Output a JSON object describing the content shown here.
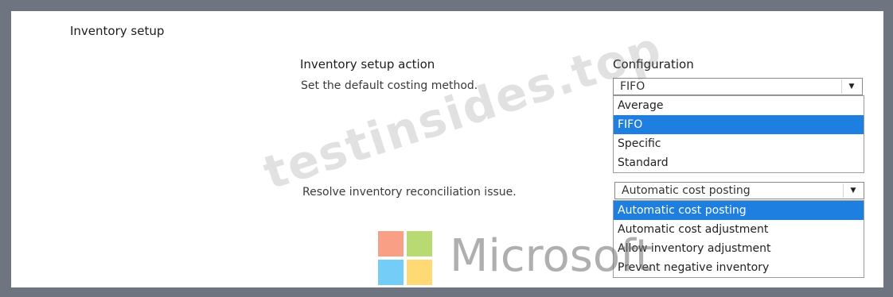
{
  "section_title": "Inventory setup",
  "columns": {
    "action": "Inventory setup action",
    "configuration": "Configuration"
  },
  "rows": [
    {
      "action": "Set the default costing method.",
      "selected": "FIFO",
      "options": [
        "Average",
        "FIFO",
        "Specific",
        "Standard"
      ],
      "highlighted_index": 1
    },
    {
      "action": "Resolve inventory reconciliation issue.",
      "selected": "Automatic cost posting",
      "options": [
        "Automatic cost posting",
        "Automatic cost adjustment",
        "Allow inventory adjustment",
        "Prevent negative inventory"
      ],
      "highlighted_index": 0
    }
  ],
  "icons": {
    "dropdown_arrow": "chevron-down-icon"
  },
  "watermark": {
    "site_text": "testinsides.top",
    "logo_text": "Microsoft"
  },
  "colors": {
    "highlight": "#1e7fe0",
    "logo_red": "#f25022",
    "logo_green": "#7fba00",
    "logo_blue": "#00a4ef",
    "logo_yellow": "#ffb900"
  }
}
